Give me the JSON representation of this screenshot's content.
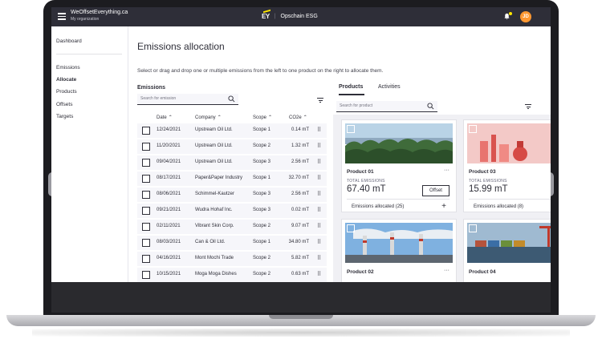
{
  "app": {
    "name": "WeOffsetEverything.ca",
    "organization": "My organization",
    "logo_text": "EY",
    "product_name": "Opschain ESG",
    "user_initials": "JD"
  },
  "sidebar": {
    "items": [
      {
        "label": "Dashboard"
      },
      {
        "label": "Emissions"
      },
      {
        "label": "Allocate"
      },
      {
        "label": "Products"
      },
      {
        "label": "Offsets"
      },
      {
        "label": "Targets"
      }
    ]
  },
  "main": {
    "title": "Emissions allocation",
    "instructions": "Select or drag and drop one or multiple emissions from the left to one product on the right to allocate them."
  },
  "emissions": {
    "title": "Emissions",
    "search_placeholder": "Search for emission",
    "columns": [
      "Date",
      "Company",
      "Scope",
      "CO2e"
    ],
    "rows": [
      {
        "date": "12/24/2021",
        "company": "Upstream Oil Ltd.",
        "scope": "Scope 1",
        "co2e": "0.14 mT"
      },
      {
        "date": "11/20/2021",
        "company": "Upstream Oil Ltd.",
        "scope": "Scope 2",
        "co2e": "1.32 mT"
      },
      {
        "date": "09/04/2021",
        "company": "Upstream Oil Ltd.",
        "scope": "Scope 3",
        "co2e": "2.56 mT"
      },
      {
        "date": "08/17/2021",
        "company": "Paper&Paper Industry",
        "scope": "Scope 1",
        "co2e": "32.70 mT"
      },
      {
        "date": "08/06/2021",
        "company": "Schimmel-Kautzer",
        "scope": "Scope 3",
        "co2e": "2.56 mT"
      },
      {
        "date": "09/21/2021",
        "company": "Wudra Hohaf Inc.",
        "scope": "Scope 3",
        "co2e": "0.02 mT"
      },
      {
        "date": "02/11/2021",
        "company": "Vibrant Skin Corp.",
        "scope": "Scope 2",
        "co2e": "9.07 mT"
      },
      {
        "date": "08/03/2021",
        "company": "Can & Oil Ltd.",
        "scope": "Scope 1",
        "co2e": "34.80 mT"
      },
      {
        "date": "04/16/2021",
        "company": "Mont Mochi Trade",
        "scope": "Scope 2",
        "co2e": "5.82 mT"
      },
      {
        "date": "10/15/2021",
        "company": "Moga Moga Dishes",
        "scope": "Scope 2",
        "co2e": "0.63 mT"
      }
    ]
  },
  "products_panel": {
    "tabs": [
      {
        "label": "Products"
      },
      {
        "label": "Activities"
      }
    ],
    "active_tab": "Products",
    "search_placeholder": "Search for product",
    "cards": [
      {
        "name": "Product 01",
        "total_label": "TOTAL EMISSIONS",
        "total": "67.40 mT",
        "offset_label": "Offset",
        "allocated": "Emissions allocated (25)",
        "more": "···"
      },
      {
        "name": "Product 03",
        "total_label": "TOTAL EMISSIONS",
        "total": "15.99 mT",
        "allocated": "Emissions allocated (8)"
      },
      {
        "name": "Product 02",
        "more": "···"
      },
      {
        "name": "Product 04"
      }
    ]
  },
  "colors": {
    "topbar": "#2e2e38",
    "accent": "#ffe600",
    "avatar": "#ff9831",
    "row_bg": "#f6f6fa"
  }
}
